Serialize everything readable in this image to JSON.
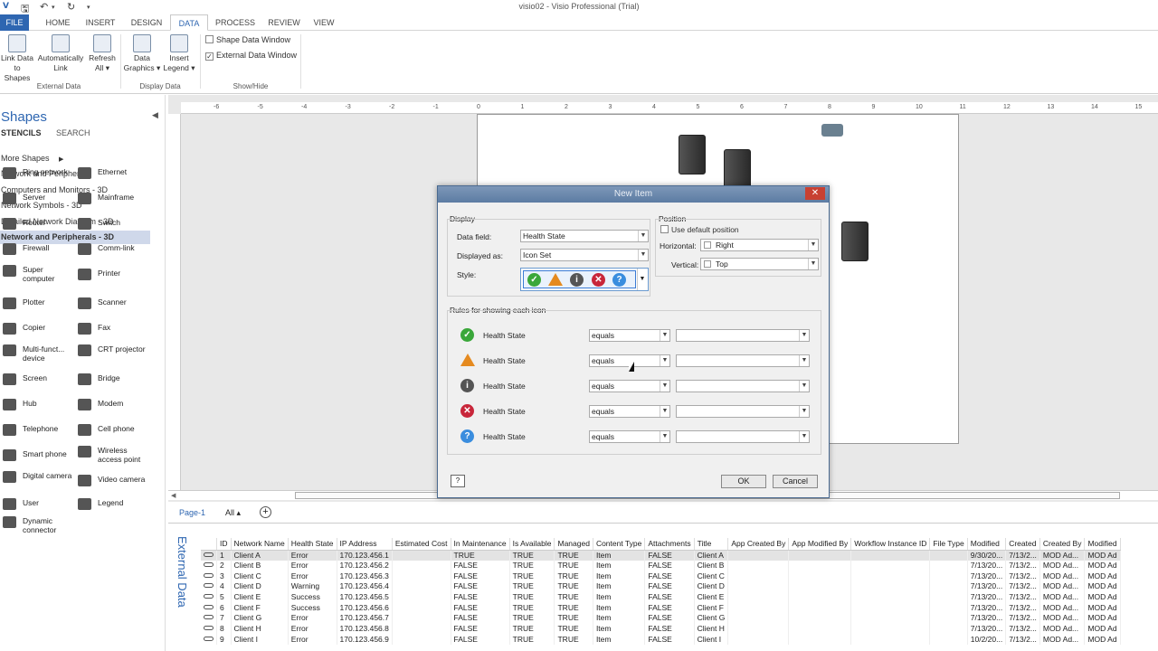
{
  "window": {
    "title": "visio02 - Visio Professional (Trial)"
  },
  "tabs": [
    {
      "label": "FILE"
    },
    {
      "label": "HOME"
    },
    {
      "label": "INSERT"
    },
    {
      "label": "DESIGN"
    },
    {
      "label": "DATA"
    },
    {
      "label": "PROCESS"
    },
    {
      "label": "REVIEW"
    },
    {
      "label": "VIEW"
    }
  ],
  "ribbon": {
    "link_data": [
      "Link Data",
      "to Shapes"
    ],
    "auto_link": [
      "Automatically",
      "Link"
    ],
    "refresh": [
      "Refresh",
      "All ▾"
    ],
    "external_group": "External Data",
    "data_graphics": [
      "Data",
      "Graphics ▾"
    ],
    "insert_legend": [
      "Insert",
      "Legend ▾"
    ],
    "display_group": "Display Data",
    "shape_data_window": "Shape Data Window",
    "external_data_window": "External Data Window",
    "showhide_group": "Show/Hide"
  },
  "shapes": {
    "title": "Shapes",
    "tab_stencils": "STENCILS",
    "tab_search": "SEARCH",
    "more_shapes": "More Shapes",
    "stencils": [
      "Network and Peripherals",
      "Computers and Monitors - 3D",
      "Network Symbols - 3D",
      "Detailed Network Diagram - 3D",
      "Network and Peripherals - 3D"
    ],
    "items": [
      [
        "Ring network",
        "Ethernet"
      ],
      [
        "Server",
        "Mainframe"
      ],
      [
        "Router",
        "Switch"
      ],
      [
        "Firewall",
        "Comm-link"
      ],
      [
        "Super computer",
        "Printer"
      ],
      [
        "Plotter",
        "Scanner"
      ],
      [
        "Copier",
        "Fax"
      ],
      [
        "Multi-funct... device",
        "CRT projector"
      ],
      [
        "Screen",
        "Bridge"
      ],
      [
        "Hub",
        "Modem"
      ],
      [
        "Telephone",
        "Cell phone"
      ],
      [
        "Smart phone",
        "Wireless access point"
      ],
      [
        "Digital camera",
        "Video camera"
      ],
      [
        "User",
        "Legend"
      ],
      [
        "Dynamic connector",
        ""
      ]
    ]
  },
  "ruler": {
    "h_ticks": [
      "-6",
      "-5",
      "-4",
      "-3",
      "-2",
      "-1",
      "0",
      "1",
      "2",
      "3",
      "4",
      "5",
      "6",
      "7",
      "8",
      "9",
      "10",
      "11",
      "12",
      "13",
      "14",
      "15"
    ]
  },
  "page_tabs": {
    "page": "Page-1",
    "all": "All ▴"
  },
  "dialog": {
    "title": "New Item",
    "display_label": "Display",
    "data_field_label": "Data field:",
    "data_field_value": "Health State",
    "displayed_as_label": "Displayed as:",
    "displayed_as_value": "Icon Set",
    "style_label": "Style:",
    "position_label": "Position",
    "use_default_position": "Use default position",
    "horizontal_label": "Horizontal:",
    "horizontal_value": "Right",
    "vertical_label": "Vertical:",
    "vertical_value": "Top",
    "rules_label": "Rules for showing each icon",
    "rules": [
      {
        "field": "Health State",
        "op": "equals",
        "value": ""
      },
      {
        "field": "Health State",
        "op": "equals",
        "value": ""
      },
      {
        "field": "Health State",
        "op": "equals",
        "value": ""
      },
      {
        "field": "Health State",
        "op": "equals",
        "value": ""
      },
      {
        "field": "Health State",
        "op": "equals",
        "value": ""
      }
    ],
    "ok": "OK",
    "cancel": "Cancel"
  },
  "external_data": {
    "label": "External Data",
    "columns": [
      "ID",
      "Network Name",
      "Health State",
      "IP Address",
      "Estimated Cost",
      "In Maintenance",
      "Is Available",
      "Managed",
      "Content Type",
      "Attachments",
      "Title",
      "App Created By",
      "App Modified By",
      "Workflow Instance ID",
      "File Type",
      "Modified",
      "Created",
      "Created By",
      "Modified"
    ],
    "rows": [
      [
        "1",
        "Client A",
        "Error",
        "170.123.456.1",
        "",
        "TRUE",
        "TRUE",
        "TRUE",
        "Item",
        "FALSE",
        "Client A",
        "",
        "",
        "",
        "",
        "9/30/20...",
        "7/13/2...",
        "MOD Ad...",
        "MOD Ad"
      ],
      [
        "2",
        "Client B",
        "Error",
        "170.123.456.2",
        "",
        "FALSE",
        "TRUE",
        "TRUE",
        "Item",
        "FALSE",
        "Client B",
        "",
        "",
        "",
        "",
        "7/13/20...",
        "7/13/2...",
        "MOD Ad...",
        "MOD Ad"
      ],
      [
        "3",
        "Client C",
        "Error",
        "170.123.456.3",
        "",
        "FALSE",
        "TRUE",
        "TRUE",
        "Item",
        "FALSE",
        "Client C",
        "",
        "",
        "",
        "",
        "7/13/20...",
        "7/13/2...",
        "MOD Ad...",
        "MOD Ad"
      ],
      [
        "4",
        "Client D",
        "Warning",
        "170.123.456.4",
        "",
        "FALSE",
        "TRUE",
        "TRUE",
        "Item",
        "FALSE",
        "Client D",
        "",
        "",
        "",
        "",
        "7/13/20...",
        "7/13/2...",
        "MOD Ad...",
        "MOD Ad"
      ],
      [
        "5",
        "Client E",
        "Success",
        "170.123.456.5",
        "",
        "FALSE",
        "TRUE",
        "TRUE",
        "Item",
        "FALSE",
        "Client E",
        "",
        "",
        "",
        "",
        "7/13/20...",
        "7/13/2...",
        "MOD Ad...",
        "MOD Ad"
      ],
      [
        "6",
        "Client F",
        "Success",
        "170.123.456.6",
        "",
        "FALSE",
        "TRUE",
        "TRUE",
        "Item",
        "FALSE",
        "Client F",
        "",
        "",
        "",
        "",
        "7/13/20...",
        "7/13/2...",
        "MOD Ad...",
        "MOD Ad"
      ],
      [
        "7",
        "Client G",
        "Error",
        "170.123.456.7",
        "",
        "FALSE",
        "TRUE",
        "TRUE",
        "Item",
        "FALSE",
        "Client G",
        "",
        "",
        "",
        "",
        "7/13/20...",
        "7/13/2...",
        "MOD Ad...",
        "MOD Ad"
      ],
      [
        "8",
        "Client H",
        "Error",
        "170.123.456.8",
        "",
        "FALSE",
        "TRUE",
        "TRUE",
        "Item",
        "FALSE",
        "Client H",
        "",
        "",
        "",
        "",
        "7/13/20...",
        "7/13/2...",
        "MOD Ad...",
        "MOD Ad"
      ],
      [
        "9",
        "Client I",
        "Error",
        "170.123.456.9",
        "",
        "FALSE",
        "TRUE",
        "TRUE",
        "Item",
        "FALSE",
        "Client I",
        "",
        "",
        "",
        "",
        "10/2/20...",
        "7/13/2...",
        "MOD Ad...",
        "MOD Ad"
      ]
    ]
  },
  "colors": {
    "accent": "#2e66b1",
    "ok": "#3aa73a",
    "warn": "#e58a1f",
    "error": "#c8263a",
    "help": "#3a8dde"
  }
}
